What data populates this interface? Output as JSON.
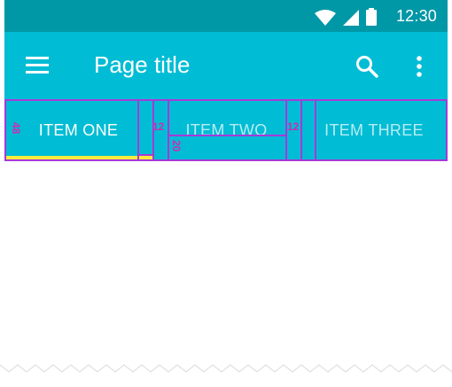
{
  "status_bar": {
    "time": "12:30",
    "icons": [
      "wifi-icon",
      "cell-signal-icon",
      "battery-icon"
    ]
  },
  "app_bar": {
    "title": "Page title",
    "icons": [
      "menu-icon",
      "search-icon",
      "more-vert-icon"
    ]
  },
  "tabs": [
    {
      "label": "ITEM ONE",
      "selected": true
    },
    {
      "label": "ITEM TWO",
      "selected": false
    },
    {
      "label": "ITEM THREE",
      "selected": false
    }
  ],
  "redlines": {
    "height_label": "48",
    "padding_left": "12",
    "padding_bottom": "20",
    "padding_right": "12"
  },
  "colors": {
    "status_bar": "#0097a7",
    "app_bar": "#00bcd4",
    "indicator": "#ffeb3b",
    "redline": "#a63ad8",
    "redline_text": "#d12ab0"
  }
}
